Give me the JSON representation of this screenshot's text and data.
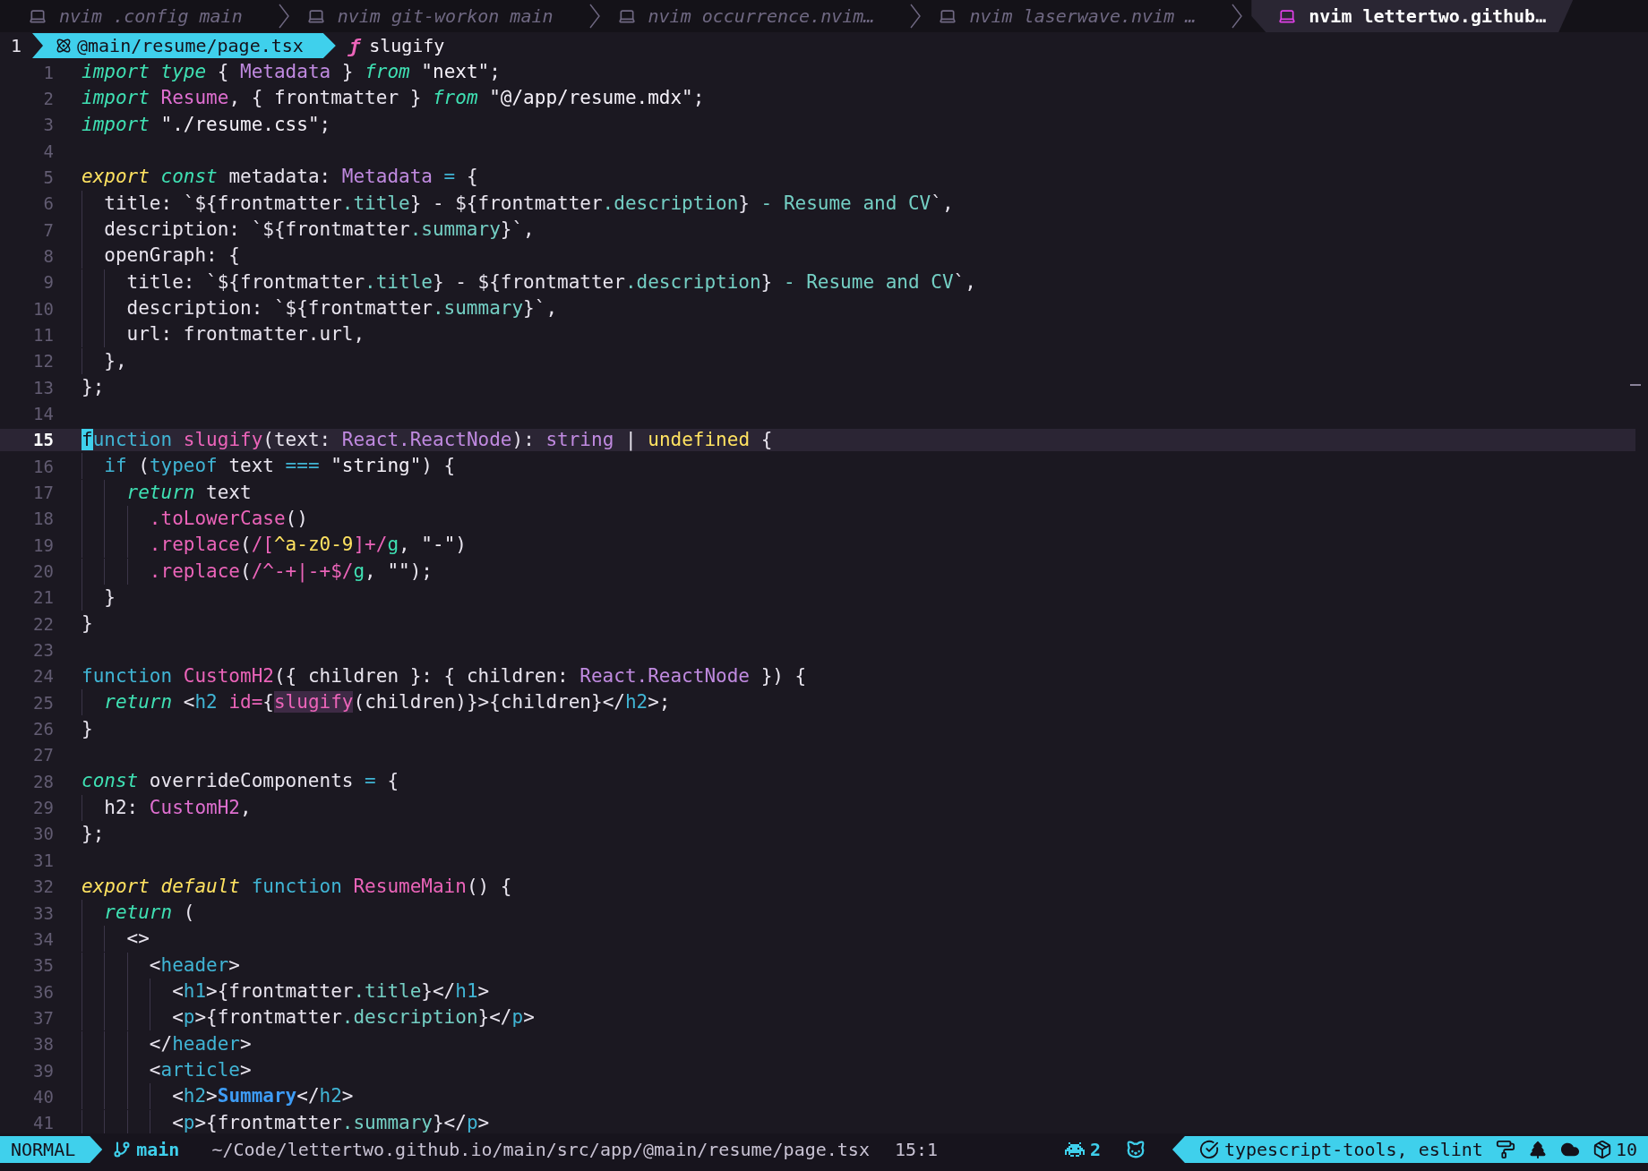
{
  "tabline": {
    "tabs": [
      {
        "label": "nvim .config main",
        "selected": false
      },
      {
        "label": "nvim git-workon main",
        "selected": false
      },
      {
        "label": "nvim occurrence.nvim…",
        "selected": false
      },
      {
        "label": "nvim laserwave.nvim …",
        "selected": false
      },
      {
        "label": "nvim lettertwo.github…",
        "selected": true
      }
    ]
  },
  "winbar": {
    "window_number": "1",
    "file": "@main/resume/page.tsx",
    "symbol_icon": "ƒ",
    "symbol": "slugify"
  },
  "editor": {
    "lines": [
      {
        "number": "1",
        "selected": false,
        "tokens": [
          {
            "text": "import ",
            "kind": "kw"
          },
          {
            "text": "type",
            "kind": "kw"
          },
          {
            "text": " { ",
            "kind": "plain"
          },
          {
            "text": "Metadata",
            "kind": "type"
          },
          {
            "text": " } ",
            "kind": "plain"
          },
          {
            "text": "from ",
            "kind": "kw"
          },
          {
            "text": "\"next\"",
            "kind": "str"
          },
          {
            "text": ";",
            "kind": "plain"
          }
        ]
      },
      {
        "number": "2",
        "selected": false,
        "tokens": [
          {
            "text": "import ",
            "kind": "kw"
          },
          {
            "text": "Resume",
            "kind": "comp"
          },
          {
            "text": ", { frontmatter } ",
            "kind": "plain"
          },
          {
            "text": "from ",
            "kind": "kw"
          },
          {
            "text": "\"@/app/resume.mdx\"",
            "kind": "str"
          },
          {
            "text": ";",
            "kind": "plain"
          }
        ]
      },
      {
        "number": "3",
        "selected": false,
        "tokens": [
          {
            "text": "import ",
            "kind": "kw"
          },
          {
            "text": "\"./resume.css\"",
            "kind": "str"
          },
          {
            "text": ";",
            "kind": "plain"
          }
        ]
      },
      {
        "number": "4",
        "selected": false
      },
      {
        "number": "5",
        "selected": false,
        "tokens": [
          {
            "text": "export ",
            "kind": "exp"
          },
          {
            "text": "const",
            "kind": "kw"
          },
          {
            "text": " metadata: ",
            "kind": "plain"
          },
          {
            "text": "Metadata ",
            "kind": "type"
          },
          {
            "text": "=",
            "kind": "ctl"
          },
          {
            "text": " {",
            "kind": "plain"
          }
        ]
      },
      {
        "number": "6",
        "selected": false,
        "tokens": [
          {
            "text": "  title: `${frontmatter",
            "kind": "plain"
          },
          {
            "text": ".title",
            "kind": "prop"
          },
          {
            "text": "} - ${frontmatter",
            "kind": "plain"
          },
          {
            "text": ".description",
            "kind": "prop"
          },
          {
            "text": "}",
            "kind": "plain"
          },
          {
            "text": " - Resume and CV",
            "kind": "prop"
          },
          {
            "text": "`,",
            "kind": "plain"
          }
        ]
      },
      {
        "number": "7",
        "selected": false,
        "tokens": [
          {
            "text": "  description: `${frontmatter",
            "kind": "plain"
          },
          {
            "text": ".summary",
            "kind": "prop"
          },
          {
            "text": "}`,",
            "kind": "plain"
          }
        ]
      },
      {
        "number": "8",
        "selected": false,
        "tokens": [
          {
            "text": "  openGraph: {",
            "kind": "plain"
          }
        ]
      },
      {
        "number": "9",
        "selected": false,
        "tokens": [
          {
            "text": "    title: `${frontmatter",
            "kind": "plain"
          },
          {
            "text": ".title",
            "kind": "prop"
          },
          {
            "text": "} - ${frontmatter",
            "kind": "plain"
          },
          {
            "text": ".description",
            "kind": "prop"
          },
          {
            "text": "}",
            "kind": "plain"
          },
          {
            "text": " - Resume and CV",
            "kind": "prop"
          },
          {
            "text": "`,",
            "kind": "plain"
          }
        ]
      },
      {
        "number": "10",
        "selected": false,
        "tokens": [
          {
            "text": "    description: `${frontmatter",
            "kind": "plain"
          },
          {
            "text": ".summary",
            "kind": "prop"
          },
          {
            "text": "}`,",
            "kind": "plain"
          }
        ]
      },
      {
        "number": "11",
        "selected": false,
        "tokens": [
          {
            "text": "    url: frontmatter.url,",
            "kind": "plain"
          }
        ]
      },
      {
        "number": "12",
        "selected": false,
        "tokens": [
          {
            "text": "  },",
            "kind": "plain"
          }
        ]
      },
      {
        "number": "13",
        "selected": false,
        "tokens": [
          {
            "text": "};",
            "kind": "plain"
          }
        ]
      },
      {
        "number": "14",
        "selected": false
      },
      {
        "number": "15",
        "selected": true,
        "tokens": [
          {
            "text": "f",
            "kind": "cursor"
          },
          {
            "text": "unction ",
            "kind": "ctl"
          },
          {
            "text": "slugify",
            "kind": "fn"
          },
          {
            "text": "(text: ",
            "kind": "plain"
          },
          {
            "text": "React.ReactNode",
            "kind": "type"
          },
          {
            "text": "): ",
            "kind": "plain"
          },
          {
            "text": "string",
            "kind": "type"
          },
          {
            "text": " | ",
            "kind": "plain"
          },
          {
            "text": "undefined",
            "kind": "yel"
          },
          {
            "text": " {",
            "kind": "plain"
          }
        ]
      },
      {
        "number": "16",
        "selected": false,
        "tokens": [
          {
            "text": "  if",
            "kind": "ctl"
          },
          {
            "text": " (",
            "kind": "plain"
          },
          {
            "text": "typeof",
            "kind": "ctl"
          },
          {
            "text": " text ",
            "kind": "plain"
          },
          {
            "text": "=== ",
            "kind": "ctl"
          },
          {
            "text": "\"string\"",
            "kind": "str"
          },
          {
            "text": ") {",
            "kind": "plain"
          }
        ]
      },
      {
        "number": "17",
        "selected": false,
        "tokens": [
          {
            "text": "    return",
            "kind": "kw"
          },
          {
            "text": " text",
            "kind": "plain"
          }
        ]
      },
      {
        "number": "18",
        "selected": false,
        "tokens": [
          {
            "text": "      .toLowerCase",
            "kind": "fn"
          },
          {
            "text": "()",
            "kind": "plain"
          }
        ]
      },
      {
        "number": "19",
        "selected": false,
        "tokens": [
          {
            "text": "      .replace",
            "kind": "fn"
          },
          {
            "text": "(",
            "kind": "plain"
          },
          {
            "text": "/[",
            "kind": "regex"
          },
          {
            "text": "^a-z0-9",
            "kind": "yel"
          },
          {
            "text": "]+/",
            "kind": "regex"
          },
          {
            "text": "g",
            "kind": "flag"
          },
          {
            "text": ", ",
            "kind": "plain"
          },
          {
            "text": "\"-\"",
            "kind": "str"
          },
          {
            "text": ")",
            "kind": "plain"
          }
        ]
      },
      {
        "number": "20",
        "selected": false,
        "tokens": [
          {
            "text": "      .replace",
            "kind": "fn"
          },
          {
            "text": "(",
            "kind": "plain"
          },
          {
            "text": "/^-+|-+$/",
            "kind": "regex"
          },
          {
            "text": "g",
            "kind": "flag"
          },
          {
            "text": ", ",
            "kind": "plain"
          },
          {
            "text": "\"\"",
            "kind": "str"
          },
          {
            "text": ");",
            "kind": "plain"
          }
        ]
      },
      {
        "number": "21",
        "selected": false,
        "tokens": [
          {
            "text": "  }",
            "kind": "plain"
          }
        ]
      },
      {
        "number": "22",
        "selected": false,
        "tokens": [
          {
            "text": "}",
            "kind": "plain"
          }
        ]
      },
      {
        "number": "23",
        "selected": false
      },
      {
        "number": "24",
        "selected": false,
        "tokens": [
          {
            "text": "function ",
            "kind": "ctl"
          },
          {
            "text": "CustomH2",
            "kind": "fn"
          },
          {
            "text": "({ children }: { children: ",
            "kind": "plain"
          },
          {
            "text": "React.ReactNode",
            "kind": "type"
          },
          {
            "text": " }) {",
            "kind": "plain"
          }
        ]
      },
      {
        "number": "25",
        "selected": false,
        "tokens": [
          {
            "text": "  return",
            "kind": "kw"
          },
          {
            "text": " <",
            "kind": "plain"
          },
          {
            "text": "h2 ",
            "kind": "ctl"
          },
          {
            "text": "id=",
            "kind": "fn"
          },
          {
            "text": "{",
            "kind": "plain"
          },
          {
            "text": "slugify",
            "kind": "match"
          },
          {
            "text": "(children)}>{children}</",
            "kind": "plain"
          },
          {
            "text": "h2",
            "kind": "ctl"
          },
          {
            "text": ">;",
            "kind": "plain"
          }
        ]
      },
      {
        "number": "26",
        "selected": false,
        "tokens": [
          {
            "text": "}",
            "kind": "plain"
          }
        ]
      },
      {
        "number": "27",
        "selected": false
      },
      {
        "number": "28",
        "selected": false,
        "tokens": [
          {
            "text": "const",
            "kind": "kw"
          },
          {
            "text": " overrideComponents ",
            "kind": "plain"
          },
          {
            "text": "=",
            "kind": "ctl"
          },
          {
            "text": " {",
            "kind": "plain"
          }
        ]
      },
      {
        "number": "29",
        "selected": false,
        "tokens": [
          {
            "text": "  h2: ",
            "kind": "plain"
          },
          {
            "text": "CustomH2",
            "kind": "comp"
          },
          {
            "text": ",",
            "kind": "plain"
          }
        ]
      },
      {
        "number": "30",
        "selected": false,
        "tokens": [
          {
            "text": "};",
            "kind": "plain"
          }
        ]
      },
      {
        "number": "31",
        "selected": false
      },
      {
        "number": "32",
        "selected": false,
        "tokens": [
          {
            "text": "export ",
            "kind": "exp"
          },
          {
            "text": "default ",
            "kind": "exp"
          },
          {
            "text": "function ",
            "kind": "ctl"
          },
          {
            "text": "ResumeMain",
            "kind": "fn"
          },
          {
            "text": "() {",
            "kind": "plain"
          }
        ]
      },
      {
        "number": "33",
        "selected": false,
        "tokens": [
          {
            "text": "  return",
            "kind": "kw"
          },
          {
            "text": " (",
            "kind": "plain"
          }
        ]
      },
      {
        "number": "34",
        "selected": false,
        "tokens": [
          {
            "text": "    <>",
            "kind": "plain"
          }
        ]
      },
      {
        "number": "35",
        "selected": false,
        "tokens": [
          {
            "text": "      <",
            "kind": "plain"
          },
          {
            "text": "header",
            "kind": "tag"
          },
          {
            "text": ">",
            "kind": "plain"
          }
        ]
      },
      {
        "number": "36",
        "selected": false,
        "tokens": [
          {
            "text": "        <",
            "kind": "plain"
          },
          {
            "text": "h1",
            "kind": "tag"
          },
          {
            "text": ">{frontmatter",
            "kind": "plain"
          },
          {
            "text": ".title",
            "kind": "prop"
          },
          {
            "text": "}</",
            "kind": "plain"
          },
          {
            "text": "h1",
            "kind": "ctl"
          },
          {
            "text": ">",
            "kind": "plain"
          }
        ]
      },
      {
        "number": "37",
        "selected": false,
        "tokens": [
          {
            "text": "        <",
            "kind": "plain"
          },
          {
            "text": "p",
            "kind": "tag"
          },
          {
            "text": ">{frontmatter",
            "kind": "plain"
          },
          {
            "text": ".description",
            "kind": "prop"
          },
          {
            "text": "}</",
            "kind": "plain"
          },
          {
            "text": "p",
            "kind": "ctl"
          },
          {
            "text": ">",
            "kind": "plain"
          }
        ]
      },
      {
        "number": "38",
        "selected": false,
        "tokens": [
          {
            "text": "      </",
            "kind": "plain"
          },
          {
            "text": "header",
            "kind": "tag"
          },
          {
            "text": ">",
            "kind": "plain"
          }
        ]
      },
      {
        "number": "39",
        "selected": false,
        "tokens": [
          {
            "text": "      <",
            "kind": "plain"
          },
          {
            "text": "article",
            "kind": "tag"
          },
          {
            "text": ">",
            "kind": "plain"
          }
        ]
      },
      {
        "number": "40",
        "selected": false,
        "tokens": [
          {
            "text": "        <",
            "kind": "plain"
          },
          {
            "text": "h2",
            "kind": "tag"
          },
          {
            "text": ">",
            "kind": "plain"
          },
          {
            "text": "Summary",
            "kind": "bold"
          },
          {
            "text": "</",
            "kind": "plain"
          },
          {
            "text": "h2",
            "kind": "tag"
          },
          {
            "text": ">",
            "kind": "plain"
          }
        ]
      },
      {
        "number": "41",
        "selected": false,
        "tokens": [
          {
            "text": "        <",
            "kind": "plain"
          },
          {
            "text": "p",
            "kind": "tag"
          },
          {
            "text": ">{frontmatter",
            "kind": "plain"
          },
          {
            "text": ".summary",
            "kind": "prop"
          },
          {
            "text": "}</",
            "kind": "plain"
          },
          {
            "text": "p",
            "kind": "ctl"
          },
          {
            "text": ">",
            "kind": "plain"
          }
        ]
      }
    ]
  },
  "status_bar": {
    "mode": "NORMAL",
    "branch": "main",
    "path": "~/Code/lettertwo.github.io/main/src/app/@main/resume/page.tsx",
    "position": "15:1",
    "copilot_count": "2",
    "lsp": "typescript-tools, eslint",
    "package_count": "10"
  }
}
